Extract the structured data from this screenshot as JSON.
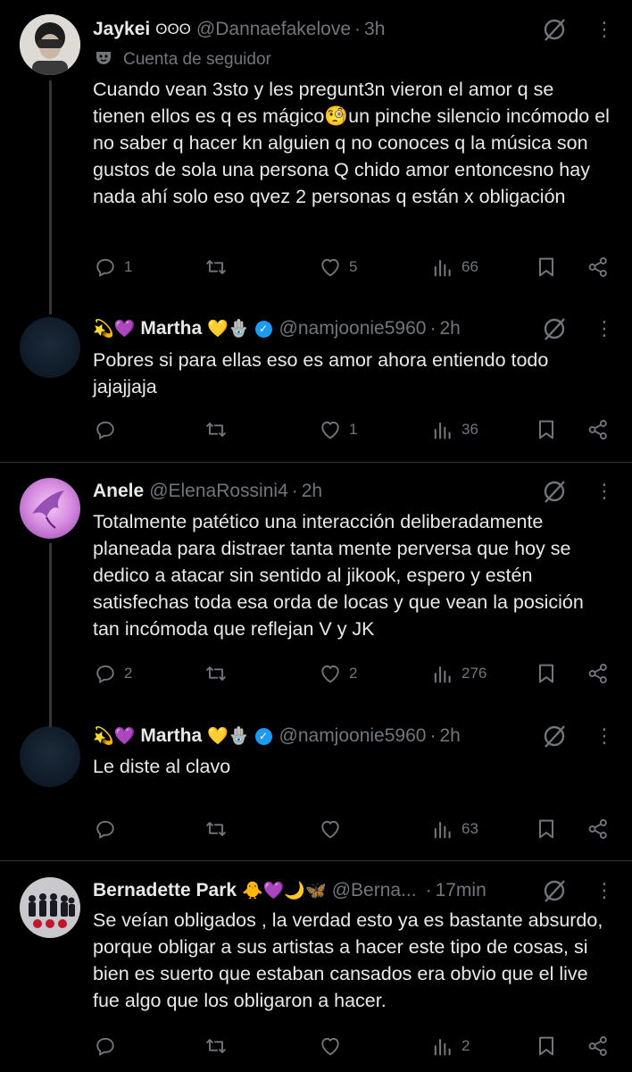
{
  "tweets": [
    {
      "name": "Jaykei",
      "name_suffix": "ʘʘʘ",
      "handle": "@Dannaefakelove",
      "time": "3h",
      "context": "Cuenta de seguidor",
      "text": "Cuando vean 3sto y les pregunt3n vieron el amor q se tienen ellos es q es mágico🧐un pinche silencio incómodo el no saber q hacer kn alguien q no conoces q la música son gustos de sola una persona Q chido amor entoncesno hay nada ahí solo eso qvez 2 personas q están x obligación",
      "replies": "1",
      "retweets": "",
      "likes": "5",
      "views": "66"
    },
    {
      "pre_emoji": "💫💜",
      "name": "Martha",
      "name_suffix": "💛🪬",
      "handle": "@namjoonie5960",
      "time": "2h",
      "text": "Pobres si para ellas eso es amor ahora entiendo todo jajajjaja",
      "replies": "",
      "retweets": "",
      "likes": "1",
      "views": "36"
    },
    {
      "name": "Anele",
      "handle": "@ElenaRossini4",
      "time": "2h",
      "text": "Totalmente  patético una interacción  deliberadamente planeada para distraer tanta mente perversa que hoy se dedico a atacar sin sentido al jikook, espero  y estén satisfechas toda esa orda de locas y que vean la posición  tan incómoda que reflejan V y JK",
      "replies": "2",
      "retweets": "",
      "likes": "2",
      "views": "276"
    },
    {
      "pre_emoji": "💫💜",
      "name": "Martha",
      "name_suffix": "💛🪬",
      "handle": "@namjoonie5960",
      "time": "2h",
      "text": "Le diste al clavo",
      "replies": "",
      "retweets": "",
      "likes": "",
      "views": "63"
    },
    {
      "name": "Bernadette Park",
      "name_suffix": "🐥💜🌙🦋",
      "handle": "@Berna...",
      "time": "17min",
      "text": "Se veían obligados , la verdad esto ya es bastante absurdo,  porque obligar a sus artistas a hacer este tipo de cosas, si bien es suerto que estaban cansados era obvio que el live fue algo que los obligaron a  hacer.",
      "replies": "",
      "retweets": "",
      "likes": "",
      "views": "2"
    }
  ],
  "ui": {
    "separator": "·",
    "more": "⋮"
  },
  "colors": {
    "background": "#000000",
    "text": "#e7e9ea",
    "muted": "#71767b",
    "divider": "#2f3336",
    "verified": "#1d9bf0"
  }
}
